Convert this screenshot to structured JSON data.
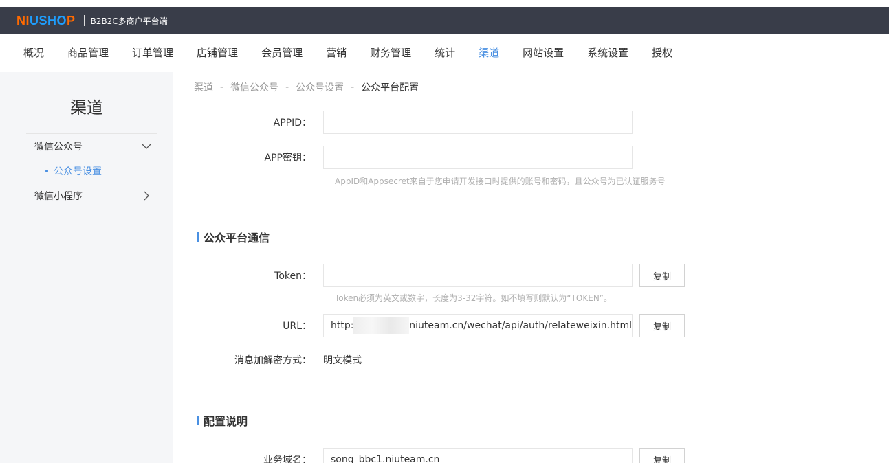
{
  "header": {
    "logo_ni": "NI",
    "logo_ushop": "USHO",
    "logo_p": "P",
    "subtitle": "B2B2C多商户平台端"
  },
  "nav": {
    "items": [
      "概况",
      "商品管理",
      "订单管理",
      "店铺管理",
      "会员管理",
      "营销",
      "财务管理",
      "统计",
      "渠道",
      "网站设置",
      "系统设置",
      "授权"
    ],
    "active_index": 8
  },
  "sidebar": {
    "title": "渠道",
    "menu": [
      {
        "label": "微信公众号",
        "expanded": true
      },
      {
        "label": "微信小程序",
        "expanded": false
      }
    ],
    "sub_item": "公众号设置"
  },
  "breadcrumb": {
    "items": [
      "渠道",
      "微信公众号",
      "公众号设置"
    ],
    "current": "公众平台配置",
    "separator": "-"
  },
  "form": {
    "appid_label": "APPID：",
    "appid_value": "",
    "secret_label": "APP密钥：",
    "secret_value": "",
    "secret_hint": "AppID和Appsecret来自于您申请开发接口时提供的账号和密码，且公众号为已认证服务号"
  },
  "comm": {
    "section_title": "公众平台通信",
    "token_label": "Token：",
    "token_value": "",
    "copy_label": "复制",
    "token_hint": "Token必须为英文或数字，长度为3-32字符。如不填写则默认为“TOKEN”。",
    "url_label": "URL：",
    "url_prefix": "http:",
    "url_suffix": "niuteam.cn/wechat/api/auth/relateweixin.html",
    "encrypt_label": "消息加解密方式：",
    "encrypt_value": "明文模式"
  },
  "config": {
    "section_title": "配置说明",
    "domain_label": "业务域名：",
    "domain_value": "song_bbc1.niuteam.cn"
  },
  "colors": {
    "accent": "#4a90e2",
    "topbar": "#393d49",
    "logo_orange": "#ff6a00",
    "logo_blue": "#1e9fff"
  }
}
